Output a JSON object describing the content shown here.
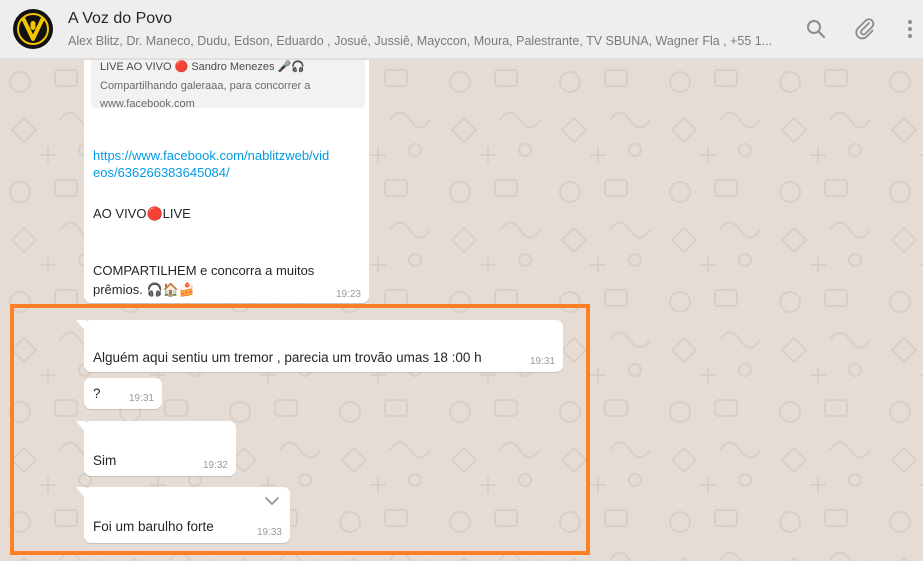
{
  "header": {
    "title": "A Voz do Povo",
    "participants": "Alex Blitz, Dr. Maneco, Dudu, Edson, Eduardo , Josué, Jussiê, Mayccon, Moura, Palestrante, TV SBUNA, Wagner Fla , +55 1...",
    "avatar_letter": "V",
    "icons": [
      "search-icon",
      "attach-icon",
      "menu-icon"
    ]
  },
  "colors": {
    "accent": "#ff7f27",
    "link": "#039be5",
    "bubble": "#ffffff",
    "background": "#e5ddd5"
  },
  "messages": {
    "m1": {
      "quote_line1": "LIVE AO VIVO 🔴 Sandro Menezes 🎤🎧",
      "quote_line2": "Compartilhando galeraaa, para concorrer a",
      "quote_line3": "www.facebook.com",
      "link_line1": "https://www.facebook.com/nablitzweb/vid",
      "link_line2": "eos/636266383645084/",
      "live": "AO VIVO🔴LIVE",
      "line1": "COMPARTILHEM e concorra a muitos",
      "line2": "prêmios. 🎧🏠🍰",
      "time": "19:23"
    },
    "m2": {
      "text": "Alguém aqui sentiu um tremor , parecia um trovão umas 18 :00 h",
      "time": "19:31"
    },
    "m3": {
      "text": "?",
      "time": "19:31"
    },
    "m4": {
      "text": "Sim",
      "time": "19:32"
    },
    "m5": {
      "text": "Foi um barulho forte",
      "time": "19:33"
    }
  }
}
